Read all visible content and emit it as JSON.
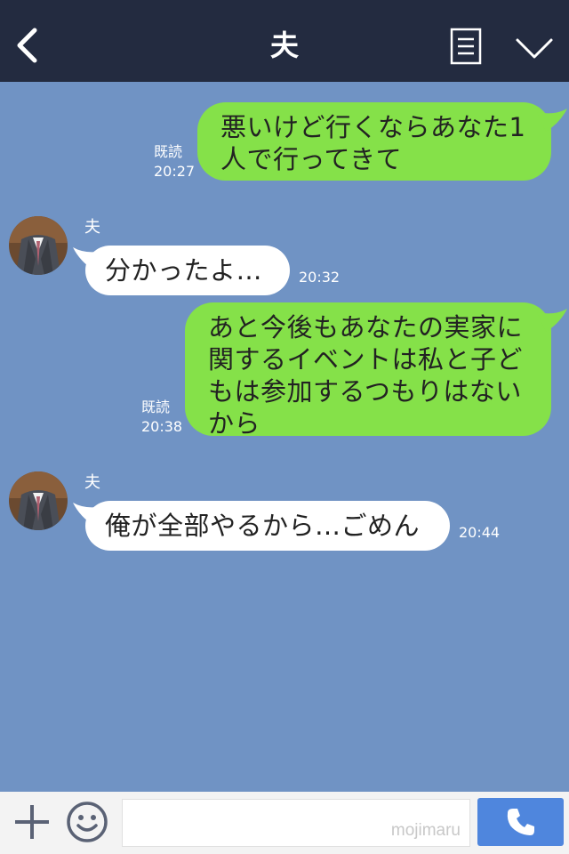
{
  "header": {
    "title": "夫"
  },
  "messages": [
    {
      "type": "sent",
      "lines": [
        "悪いけど行くならあなた1",
        "人で行ってきて"
      ],
      "read": "既読",
      "time": "20:27"
    },
    {
      "type": "received",
      "sender": "夫",
      "text": "分かったよ…",
      "time": "20:32"
    },
    {
      "type": "sent",
      "lines": [
        "あと今後もあなたの実家に",
        "関するイベントは私と子ど",
        "もは参加するつもりはない",
        "から"
      ],
      "read": "既読",
      "time": "20:38"
    },
    {
      "type": "received",
      "sender": "夫",
      "text": "俺が全部やるから…ごめん",
      "time": "20:44"
    }
  ],
  "input": {
    "watermark": "mojimaru"
  },
  "icons": {
    "back": "back-chevron-icon",
    "menu": "notes-menu-icon",
    "collapse": "chevron-down-icon",
    "add": "plus-icon",
    "emoji": "smiley-icon",
    "call": "phone-icon"
  },
  "colors": {
    "header_bg": "#232b40",
    "chat_bg": "#7093c4",
    "sent_bubble": "#85e149",
    "received_bubble": "#ffffff",
    "call_button": "#4f86dd"
  }
}
